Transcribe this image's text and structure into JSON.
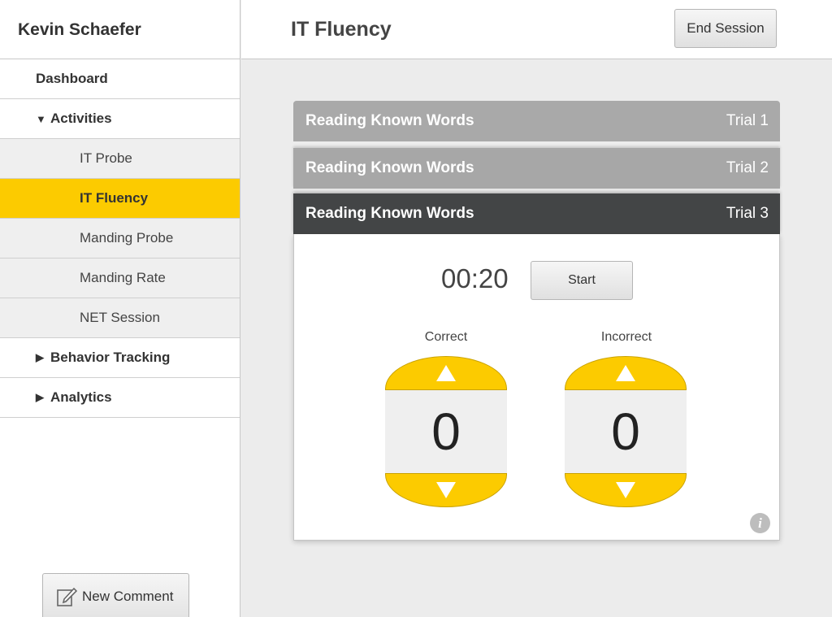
{
  "user": {
    "name": "Kevin Schaefer"
  },
  "header": {
    "title": "IT Fluency",
    "end_session_label": "End Session"
  },
  "sidebar": {
    "dashboard": "Dashboard",
    "activities": {
      "label": "Activities",
      "expanded": true,
      "items": [
        "IT Probe",
        "IT Fluency",
        "Manding Probe",
        "Manding Rate",
        "NET Session"
      ],
      "active": "IT Fluency"
    },
    "behavior_tracking": "Behavior Tracking",
    "analytics": "Analytics",
    "new_comment_label": "New Comment"
  },
  "trials": [
    {
      "title": "Reading Known Words",
      "label": "Trial 1"
    },
    {
      "title": "Reading Known Words",
      "label": "Trial 2"
    },
    {
      "title": "Reading Known Words",
      "label": "Trial 3",
      "active": true
    }
  ],
  "session": {
    "timer": "00:20",
    "start_label": "Start",
    "correct": {
      "label": "Correct",
      "value": "0"
    },
    "incorrect": {
      "label": "Incorrect",
      "value": "0"
    }
  },
  "colors": {
    "accent": "#fccb00",
    "active_trial_bar": "#434546",
    "inactive_trial_bar": "#a9a9a9"
  },
  "icons": {
    "info": "info-icon",
    "comment": "edit-comment-icon",
    "up": "triangle-up-icon",
    "down": "triangle-down-icon"
  }
}
